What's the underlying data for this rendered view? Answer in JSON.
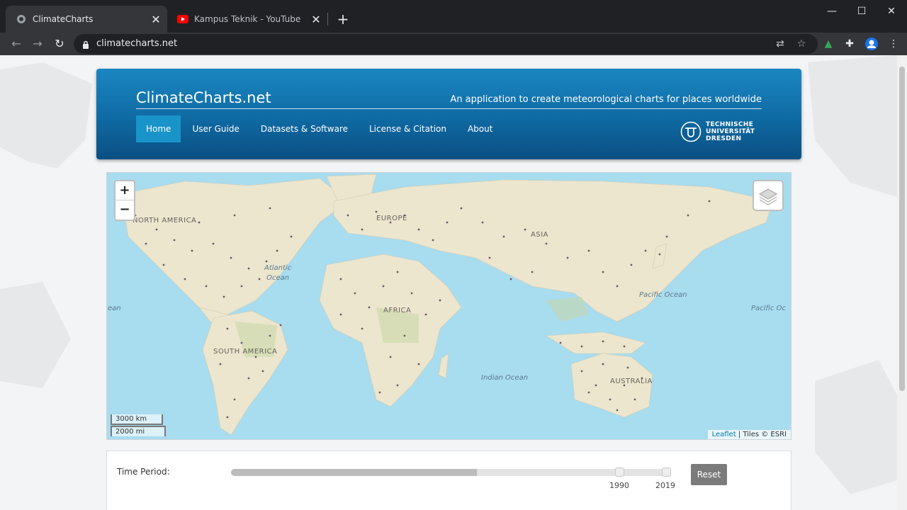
{
  "browser": {
    "tabs": [
      {
        "title": "ClimateCharts",
        "active": true
      },
      {
        "title": "Kampus Teknik - YouTube",
        "active": false
      }
    ],
    "new_tab_label": "+",
    "url": "climatecharts.net",
    "window_controls": [
      "minimize-icon",
      "maximize-icon",
      "close-icon"
    ]
  },
  "header": {
    "site_title": "ClimateCharts.net",
    "tagline": "An application to create meteorological charts for places worldwide",
    "nav": [
      {
        "label": "Home",
        "active": true
      },
      {
        "label": "User Guide",
        "active": false
      },
      {
        "label": "Datasets & Software",
        "active": false
      },
      {
        "label": "License & Citation",
        "active": false
      },
      {
        "label": "About",
        "active": false
      }
    ],
    "logo_text": [
      "TECHNISCHE",
      "UNIVERSITÄT",
      "DRESDEN"
    ]
  },
  "map": {
    "zoom_in": "+",
    "zoom_out": "−",
    "labels": {
      "north_america": "NORTH AMERICA",
      "south_america": "SOUTH AMERICA",
      "europe": "EUROPE",
      "africa": "AFRICA",
      "asia": "ASIA",
      "australia": "AUSTRALIA",
      "atlantic": "Atlantic\nOcean",
      "pacific": "Pacific Ocean",
      "pacific_right": "Pacific Oc",
      "ocean_left": "ean",
      "indian": "Indian Ocean"
    },
    "scale_km": "3000 km",
    "scale_mi": "2000 mi",
    "attribution_link": "Leaflet",
    "attribution_text": " | Tiles © ESRI"
  },
  "controls": {
    "time_period_label": "Time Period:",
    "slider_fill_fraction": 0.56,
    "range_start": "1990",
    "range_end": "2019",
    "reset_label": "Reset"
  }
}
